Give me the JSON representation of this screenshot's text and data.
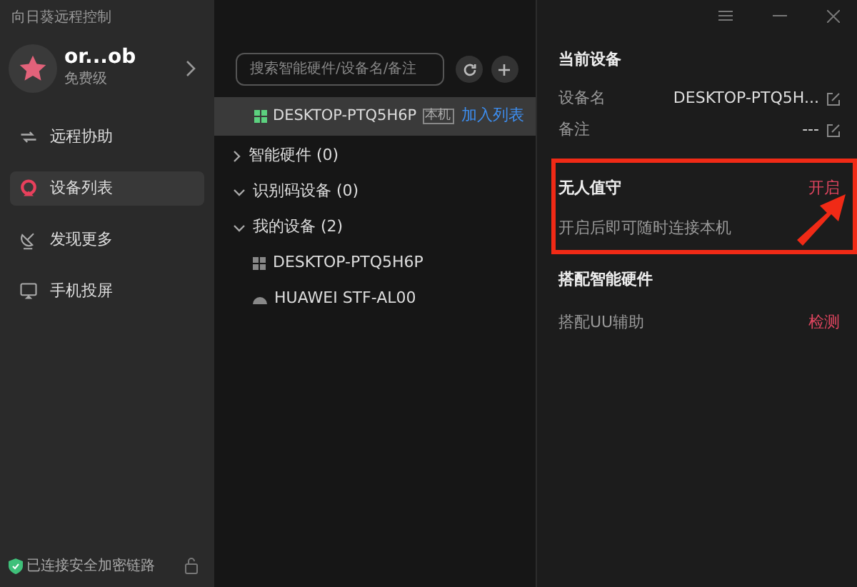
{
  "window": {
    "title": "向日葵远程控制"
  },
  "sidebar": {
    "user": {
      "name": "or...ob",
      "level": "免费级"
    },
    "items": [
      {
        "label": "远程协助",
        "selected": false
      },
      {
        "label": "设备列表",
        "selected": true
      },
      {
        "label": "发现更多",
        "selected": false
      },
      {
        "label": "手机投屏",
        "selected": false
      }
    ],
    "status": "已连接安全加密链路"
  },
  "device_list": {
    "search": {
      "placeholder": "搜索智能硬件/设备名/备注"
    },
    "current": {
      "name": "DESKTOP-PTQ5H6P",
      "tag": "本机",
      "action": "加入列表",
      "selected": true
    },
    "groups": [
      {
        "label": "智能硬件 (0)",
        "expanded": false
      },
      {
        "label": "识别码设备 (0)",
        "expanded": true
      },
      {
        "label": "我的设备 (2)",
        "expanded": true,
        "children": [
          {
            "name": "DESKTOP-PTQ5H6P",
            "kind": "pc"
          },
          {
            "name": "HUAWEI STF-AL00",
            "kind": "phone"
          }
        ]
      }
    ]
  },
  "detail": {
    "title": "当前设备",
    "fields": [
      {
        "label": "设备名",
        "value": "DESKTOP-PTQ5H..."
      },
      {
        "label": "备注",
        "value": "---"
      }
    ],
    "unattended": {
      "title": "无人值守",
      "action": "开启",
      "description": "开启后即可随时连接本机"
    },
    "hardware": {
      "title": "搭配智能硬件",
      "rows": [
        {
          "label": "搭配UU辅助",
          "action": "检测"
        }
      ]
    }
  }
}
